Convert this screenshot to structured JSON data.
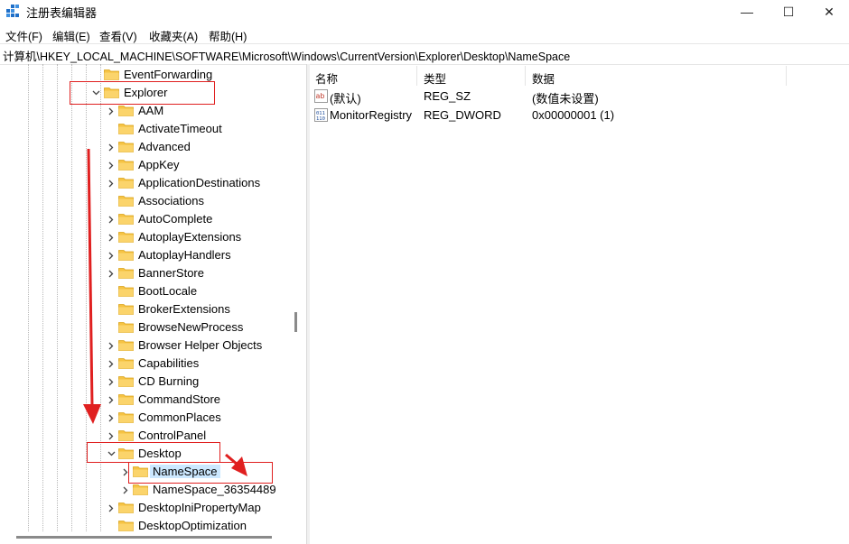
{
  "window": {
    "title": "注册表编辑器",
    "minimize": "—",
    "maximize": "☐",
    "close": "✕"
  },
  "menu": [
    "文件(F)",
    "编辑(E)",
    "查看(V)",
    "收藏夹(A)",
    "帮助(H)"
  ],
  "address": "计算机\\HKEY_LOCAL_MACHINE\\SOFTWARE\\Microsoft\\Windows\\CurrentVersion\\Explorer\\Desktop\\NameSpace",
  "tree": [
    {
      "label": "EventForwarding",
      "level": 0,
      "expander": "none"
    },
    {
      "label": "Explorer",
      "level": 0,
      "expander": "expanded"
    },
    {
      "label": "AAM",
      "level": 1,
      "expander": "collapsed"
    },
    {
      "label": "ActivateTimeout",
      "level": 1,
      "expander": "none"
    },
    {
      "label": "Advanced",
      "level": 1,
      "expander": "collapsed"
    },
    {
      "label": "AppKey",
      "level": 1,
      "expander": "collapsed"
    },
    {
      "label": "ApplicationDestinations",
      "level": 1,
      "expander": "collapsed"
    },
    {
      "label": "Associations",
      "level": 1,
      "expander": "none"
    },
    {
      "label": "AutoComplete",
      "level": 1,
      "expander": "collapsed"
    },
    {
      "label": "AutoplayExtensions",
      "level": 1,
      "expander": "collapsed"
    },
    {
      "label": "AutoplayHandlers",
      "level": 1,
      "expander": "collapsed"
    },
    {
      "label": "BannerStore",
      "level": 1,
      "expander": "collapsed"
    },
    {
      "label": "BootLocale",
      "level": 1,
      "expander": "none"
    },
    {
      "label": "BrokerExtensions",
      "level": 1,
      "expander": "none"
    },
    {
      "label": "BrowseNewProcess",
      "level": 1,
      "expander": "none"
    },
    {
      "label": "Browser Helper Objects",
      "level": 1,
      "expander": "collapsed"
    },
    {
      "label": "Capabilities",
      "level": 1,
      "expander": "collapsed"
    },
    {
      "label": "CD Burning",
      "level": 1,
      "expander": "collapsed"
    },
    {
      "label": "CommandStore",
      "level": 1,
      "expander": "collapsed"
    },
    {
      "label": "CommonPlaces",
      "level": 1,
      "expander": "collapsed"
    },
    {
      "label": "ControlPanel",
      "level": 1,
      "expander": "collapsed"
    },
    {
      "label": "Desktop",
      "level": 1,
      "expander": "expanded"
    },
    {
      "label": "NameSpace",
      "level": 2,
      "expander": "collapsed",
      "selected": true
    },
    {
      "label": "NameSpace_36354489",
      "level": 2,
      "expander": "collapsed"
    },
    {
      "label": "DesktopIniPropertyMap",
      "level": 1,
      "expander": "collapsed"
    },
    {
      "label": "DesktopOptimization",
      "level": 1,
      "expander": "none"
    }
  ],
  "columns": {
    "name": "名称",
    "type": "类型",
    "data": "数据"
  },
  "values": [
    {
      "name": "(默认)",
      "type": "REG_SZ",
      "data": "(数值未设置)",
      "icon": "string-value-icon"
    },
    {
      "name": "MonitorRegistry",
      "type": "REG_DWORD",
      "data": "0x00000001 (1)",
      "icon": "binary-value-icon"
    }
  ],
  "colors": {
    "selection": "#cce8ff",
    "annotation": "#e02020",
    "folder": "#f6c343"
  }
}
